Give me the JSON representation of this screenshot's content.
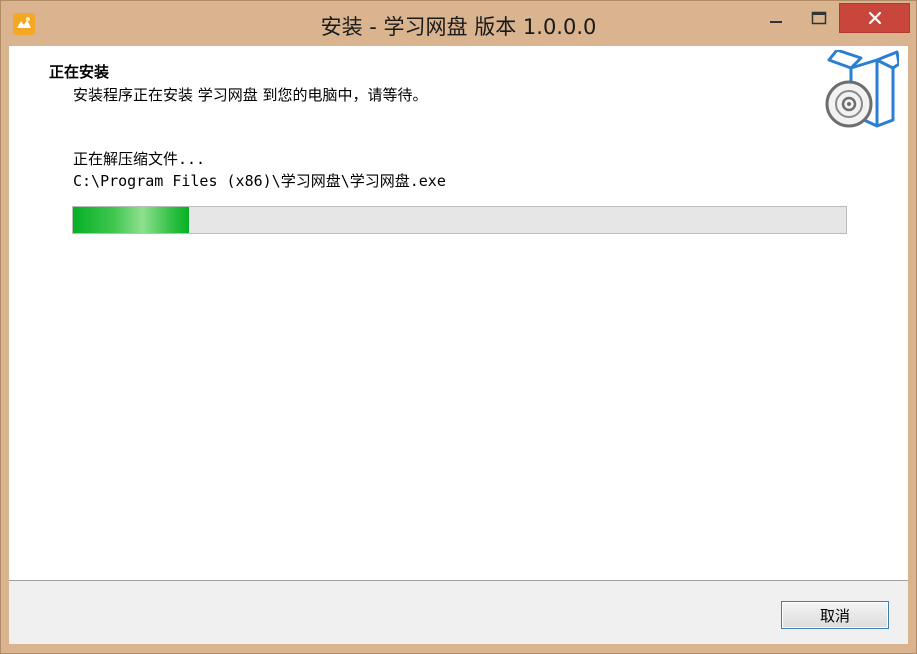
{
  "window": {
    "title": "安装 - 学习网盘 版本 1.0.0.0",
    "accent": "#d9b48e",
    "close_color": "#c9463d"
  },
  "header": {
    "title": "正在安装",
    "subtitle": "安装程序正在安装 学习网盘 到您的电脑中，请等待。",
    "icon": "software-box-disc-icon"
  },
  "status": {
    "label": "正在解压缩文件...",
    "path": "C:\\Program Files (x86)\\学习网盘\\学习网盘.exe"
  },
  "progress": {
    "fraction": 0.15,
    "color": "#06b025"
  },
  "footer": {
    "cancel_label": "取消"
  }
}
